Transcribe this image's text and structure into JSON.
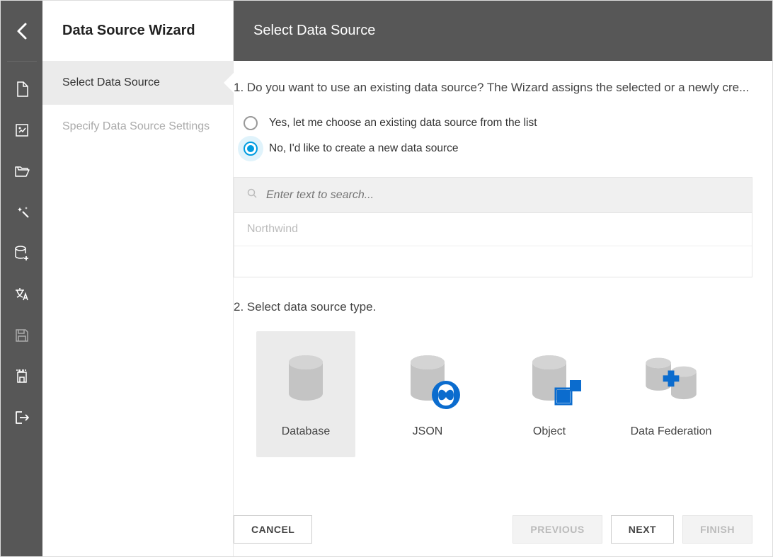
{
  "wizard": {
    "title": "Data Source Wizard",
    "steps": [
      {
        "label": "Select Data Source",
        "active": true
      },
      {
        "label": "Specify Data Source Settings",
        "active": false
      }
    ]
  },
  "main": {
    "header": "Select Data Source",
    "question1": "1. Do you want to use an existing data source? The Wizard assigns the selected or a newly cre...",
    "radio_options": [
      {
        "label": "Yes, let me choose an existing data source from the list",
        "selected": false
      },
      {
        "label": "No, I'd like to create a new data source",
        "selected": true
      }
    ],
    "search": {
      "placeholder": "Enter text to search..."
    },
    "list_items": [
      "Northwind"
    ],
    "question2": "2. Select data source type.",
    "source_types": [
      {
        "label": "Database",
        "selected": true
      },
      {
        "label": "JSON",
        "selected": false
      },
      {
        "label": "Object",
        "selected": false
      },
      {
        "label": "Data Federation",
        "selected": false
      }
    ]
  },
  "footer": {
    "cancel": "CANCEL",
    "previous": "PREVIOUS",
    "next": "NEXT",
    "finish": "FINISH"
  }
}
